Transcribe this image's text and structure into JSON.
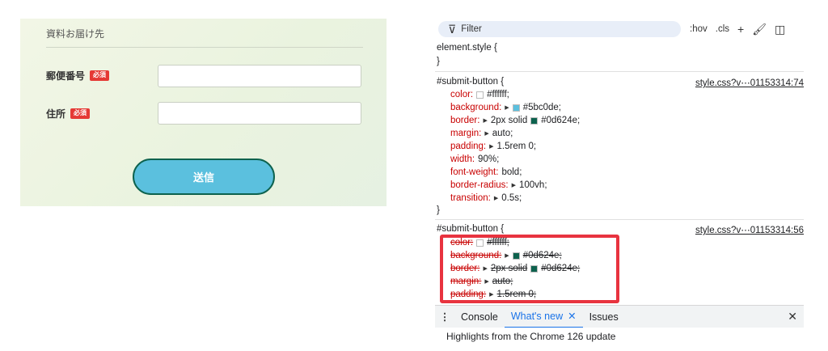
{
  "form": {
    "heading": "資料お届け先",
    "fields": [
      {
        "label": "郵便番号",
        "badge": "必須",
        "value": ""
      },
      {
        "label": "住所",
        "badge": "必須",
        "value": ""
      }
    ],
    "submit_label": "送信"
  },
  "devtools": {
    "filter_placeholder": "Filter",
    "tools": {
      "hov": ":hov",
      "cls": ".cls",
      "add": "+"
    },
    "element_style": "element.style {",
    "close_brace": "}",
    "rule1": {
      "selector": "#submit-button {",
      "source": "style.css?v⋯01153314:74",
      "props": [
        {
          "name": "color:",
          "value": "#ffffff;",
          "swatch": "#ffffff"
        },
        {
          "name": "background:",
          "value": "#5bc0de;",
          "swatch": "#5bc0de"
        },
        {
          "name": "border:",
          "value": "2px solid",
          "swatch": "#0d624e",
          "value2": "#0d624e;"
        },
        {
          "name": "margin:",
          "value": "auto;"
        },
        {
          "name": "padding:",
          "value": "1.5rem 0;"
        },
        {
          "name": "width:",
          "value": "90%;"
        },
        {
          "name": "font-weight:",
          "value": "bold;"
        },
        {
          "name": "border-radius:",
          "value": "100vh;"
        },
        {
          "name": "transition:",
          "value": "0.5s;"
        }
      ]
    },
    "rule2": {
      "selector": "#submit-button {",
      "source": "style.css?v⋯01153314:56",
      "props": [
        {
          "name": "color:",
          "value": "#ffffff;",
          "swatch": "#ffffff"
        },
        {
          "name": "background:",
          "value": "#0d624e;",
          "swatch": "#0d624e"
        },
        {
          "name": "border:",
          "value": "2px solid",
          "swatch": "#0d624e",
          "value2": "#0d624e;"
        },
        {
          "name": "margin:",
          "value": "auto;"
        },
        {
          "name": "padding:",
          "value": "1.5rem 0;"
        }
      ]
    },
    "drawer": {
      "tabs": [
        "Console",
        "What's new",
        "Issues"
      ],
      "active_tab": "What's new",
      "content": "Highlights from the Chrome 126 update"
    },
    "colors": {
      "highlight": "#e8333f",
      "link_active": "#1a73e8"
    }
  }
}
